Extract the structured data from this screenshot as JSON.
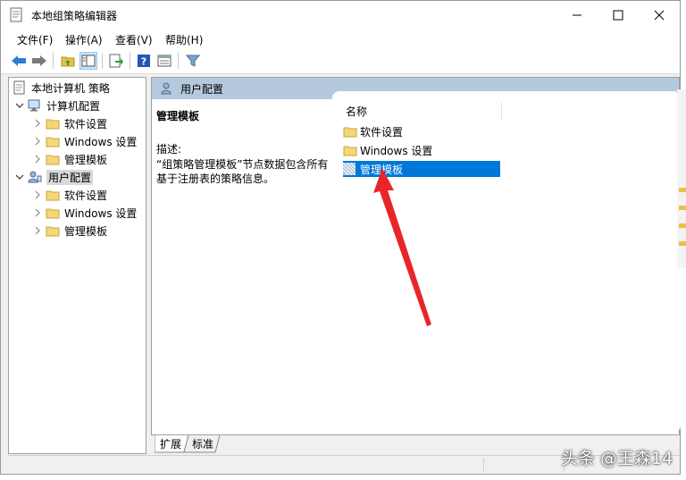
{
  "window": {
    "title": "本地组策略编辑器"
  },
  "menu": [
    "文件(F)",
    "操作(A)",
    "查看(V)",
    "帮助(H)"
  ],
  "tree": {
    "root": "本地计算机 策略",
    "computer": "计算机配置",
    "computer_children": [
      "软件设置",
      "Windows 设置",
      "管理模板"
    ],
    "user": "用户配置",
    "user_children": [
      "软件设置",
      "Windows 设置",
      "管理模板"
    ]
  },
  "right": {
    "header": "用户配置",
    "desc_title": "管理模板",
    "desc_label": "描述:",
    "desc_body": "“组策略管理模板”节点数据包含所有基于注册表的策略信息。",
    "column_name": "名称",
    "items": [
      "软件设置",
      "Windows 设置",
      "管理模板"
    ],
    "selected_index": 2
  },
  "tabs": [
    "扩展",
    "标准"
  ],
  "watermark": "头条 @王森14",
  "colors": {
    "selection": "#0078d7",
    "header_band": "#b5c9de",
    "arrow": "#e8262a"
  }
}
